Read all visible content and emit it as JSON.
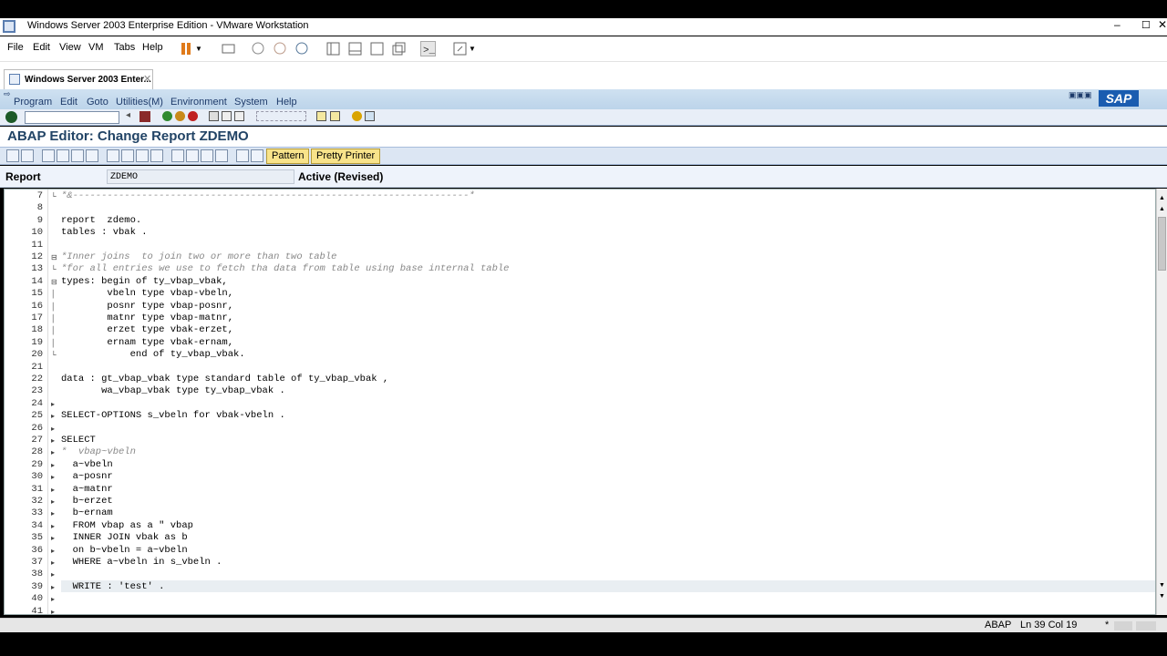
{
  "window": {
    "title": "Windows Server 2003 Enterprise Edition - VMware Workstation"
  },
  "vm_menu": [
    "File",
    "Edit",
    "View",
    "VM",
    "Tabs",
    "Help"
  ],
  "vm_tab": {
    "label": "Windows Server 2003 Enter..."
  },
  "sap_menu": [
    "Program",
    "Edit",
    "Goto",
    "Utilities(M)",
    "Environment",
    "System",
    "Help"
  ],
  "sap_logo": "SAP",
  "page_title": "ABAP Editor: Change Report ZDEMO",
  "app_toolbar": {
    "pattern": "Pattern",
    "pretty_printer": "Pretty Printer"
  },
  "report_header": {
    "label": "Report",
    "value": "ZDEMO",
    "status": "Active (Revised)"
  },
  "code_lines": [
    {
      "n": "7",
      "t": "*&---------------------------------------------------------------------*",
      "c": true,
      "m": "└"
    },
    {
      "n": "8",
      "t": "",
      "c": false,
      "m": ""
    },
    {
      "n": "9",
      "t": "report  zdemo.",
      "c": false,
      "m": ""
    },
    {
      "n": "10",
      "t": "tables : vbak .",
      "c": false,
      "m": ""
    },
    {
      "n": "11",
      "t": "",
      "c": false,
      "m": ""
    },
    {
      "n": "12",
      "t": "*Inner joins  to join two or more than two table",
      "c": true,
      "m": "⊟"
    },
    {
      "n": "13",
      "t": "*for all entries we use to fetch tha data from table using base internal table",
      "c": true,
      "m": "└"
    },
    {
      "n": "14",
      "t": "types: begin of ty_vbap_vbak,",
      "c": false,
      "m": "⊟"
    },
    {
      "n": "15",
      "t": "        vbeln type vbap-vbeln,",
      "c": false,
      "m": "│"
    },
    {
      "n": "16",
      "t": "        posnr type vbap-posnr,",
      "c": false,
      "m": "│"
    },
    {
      "n": "17",
      "t": "        matnr type vbap-matnr,",
      "c": false,
      "m": "│"
    },
    {
      "n": "18",
      "t": "        erzet type vbak-erzet,",
      "c": false,
      "m": "│"
    },
    {
      "n": "19",
      "t": "        ernam type vbak-ernam,",
      "c": false,
      "m": "│"
    },
    {
      "n": "20",
      "t": "            end of ty_vbap_vbak.",
      "c": false,
      "m": "└"
    },
    {
      "n": "21",
      "t": "",
      "c": false,
      "m": ""
    },
    {
      "n": "22",
      "t": "data : gt_vbap_vbak type standard table of ty_vbap_vbak ,",
      "c": false,
      "m": ""
    },
    {
      "n": "23",
      "t": "       wa_vbap_vbak type ty_vbap_vbak .",
      "c": false,
      "m": ""
    },
    {
      "n": "24",
      "t": "",
      "c": false,
      "m": "▸"
    },
    {
      "n": "25",
      "t": "SELECT-OPTIONS s_vbeln for vbak-vbeln .",
      "c": false,
      "m": "▸"
    },
    {
      "n": "26",
      "t": "",
      "c": false,
      "m": "▸"
    },
    {
      "n": "27",
      "t": "SELECT",
      "c": false,
      "m": "▸"
    },
    {
      "n": "28",
      "t": "*  vbap~vbeln",
      "c": true,
      "m": "▸"
    },
    {
      "n": "29",
      "t": "  a~vbeln",
      "c": false,
      "m": "▸"
    },
    {
      "n": "30",
      "t": "  a~posnr",
      "c": false,
      "m": "▸"
    },
    {
      "n": "31",
      "t": "  a~matnr",
      "c": false,
      "m": "▸"
    },
    {
      "n": "32",
      "t": "  b~erzet",
      "c": false,
      "m": "▸"
    },
    {
      "n": "33",
      "t": "  b~ernam",
      "c": false,
      "m": "▸"
    },
    {
      "n": "34",
      "t": "  FROM vbap as a \" vbap",
      "c": false,
      "m": "▸"
    },
    {
      "n": "35",
      "t": "  INNER JOIN vbak as b",
      "c": false,
      "m": "▸"
    },
    {
      "n": "36",
      "t": "  on b~vbeln = a~vbeln",
      "c": false,
      "m": "▸"
    },
    {
      "n": "37",
      "t": "  WHERE a~vbeln in s_vbeln .",
      "c": false,
      "m": "▸"
    },
    {
      "n": "38",
      "t": "",
      "c": false,
      "m": "▸"
    },
    {
      "n": "39",
      "t": "  WRITE : 'test' .",
      "c": false,
      "m": "▸"
    },
    {
      "n": "40",
      "t": "",
      "c": false,
      "m": "▸"
    },
    {
      "n": "41",
      "t": "",
      "c": false,
      "m": "▸"
    }
  ],
  "status": {
    "lang": "ABAP",
    "pos": "Ln  39 Col  19",
    "star": "*"
  },
  "colors": {
    "sap_header": "#bcd4ea",
    "title_blue": "#224466",
    "pattern_button": "#f8e38a"
  }
}
